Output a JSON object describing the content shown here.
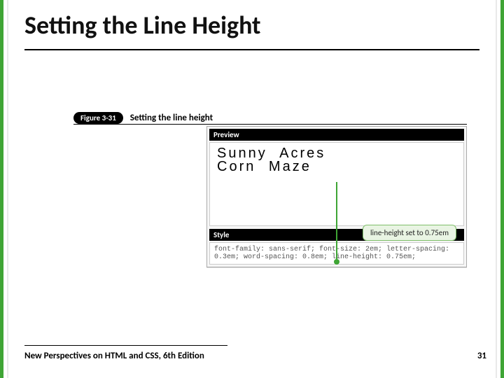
{
  "colors": {
    "accent": "#3fa535"
  },
  "title": "Setting the Line Height",
  "figure": {
    "badge": "Figure 3-31",
    "caption": "Setting the line height",
    "preview_label": "Preview",
    "preview_line1": "Sunny Acres",
    "preview_line2": "Corn Maze",
    "callout": "line-height set to 0.75em",
    "style_label": "Style",
    "style_code": "font-family: sans-serif; font-size: 2em; letter-spacing: 0.3em; word-spacing: 0.8em; line-height: 0.75em;"
  },
  "footer": {
    "book": "New Perspectives on HTML and CSS, 6th Edition",
    "page": "31"
  }
}
